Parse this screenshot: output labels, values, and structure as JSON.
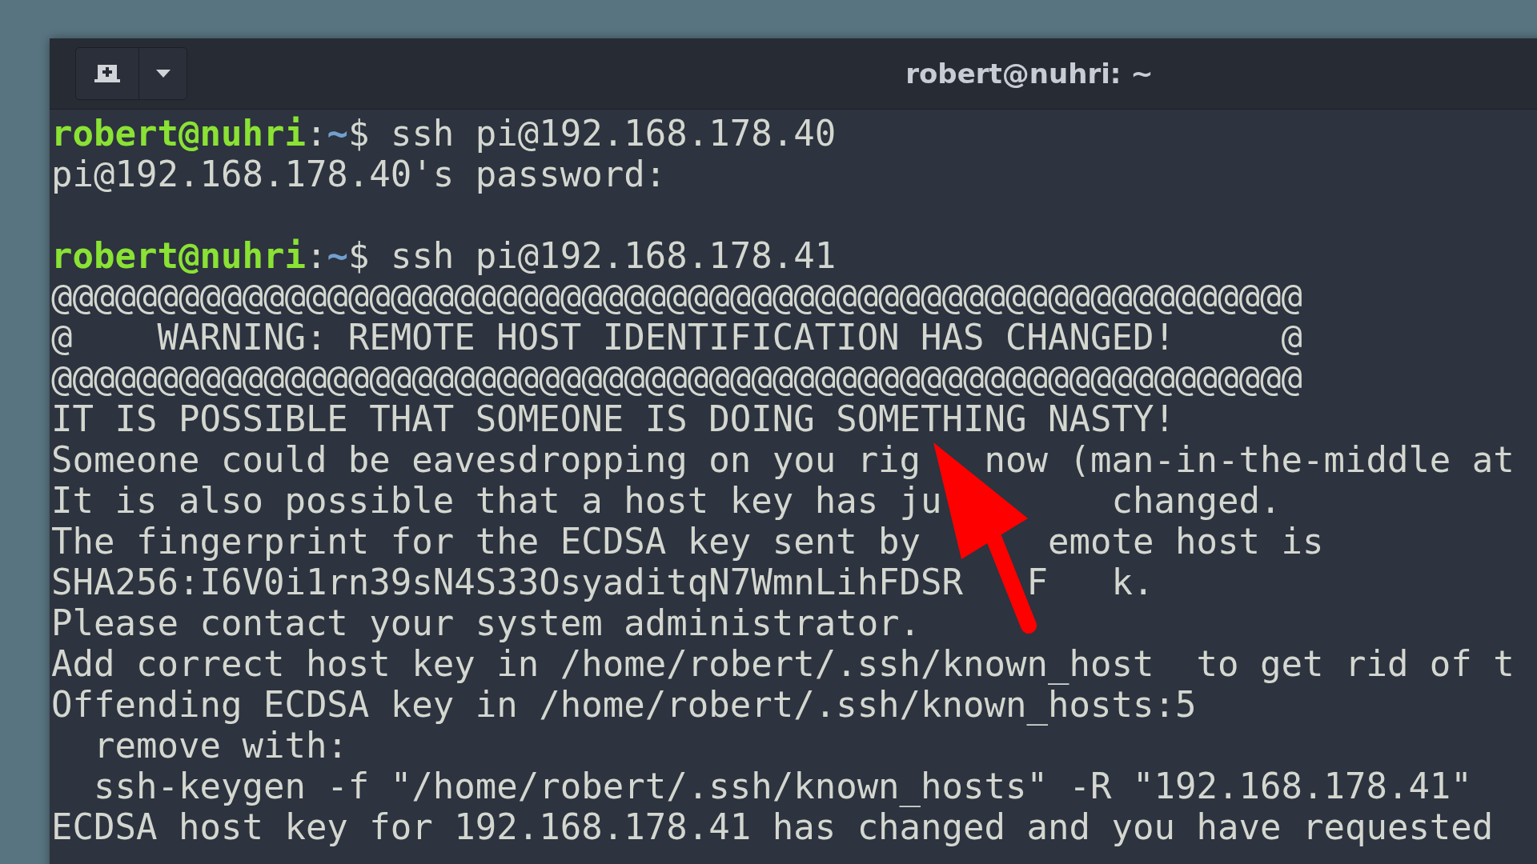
{
  "window": {
    "title": "robert@nuhri: ~"
  },
  "lines": [
    {
      "kind": "prompt",
      "user_host": "robert@nuhri",
      "separator": ":",
      "path": "~",
      "symbol": "$",
      "command": "ssh pi@192.168.178.40"
    },
    {
      "kind": "output",
      "text": "pi@192.168.178.40's password:"
    },
    {
      "kind": "blank"
    },
    {
      "kind": "prompt",
      "user_host": "robert@nuhri",
      "separator": ":",
      "path": "~",
      "symbol": "$",
      "command": "ssh pi@192.168.178.41"
    },
    {
      "kind": "output",
      "text": "@@@@@@@@@@@@@@@@@@@@@@@@@@@@@@@@@@@@@@@@@@@@@@@@@@@@@@@@@@@"
    },
    {
      "kind": "output",
      "text": "@    WARNING: REMOTE HOST IDENTIFICATION HAS CHANGED!     @"
    },
    {
      "kind": "output",
      "text": "@@@@@@@@@@@@@@@@@@@@@@@@@@@@@@@@@@@@@@@@@@@@@@@@@@@@@@@@@@@"
    },
    {
      "kind": "output",
      "text": "IT IS POSSIBLE THAT SOMEONE IS DOING SOMETHING NASTY!"
    },
    {
      "kind": "output",
      "text": "Someone could be eavesdropping on you rig   now (man-in-the-middle at"
    },
    {
      "kind": "output",
      "text": "It is also possible that a host key has ju        changed."
    },
    {
      "kind": "output",
      "text": "The fingerprint for the ECDSA key sent by      emote host is"
    },
    {
      "kind": "output",
      "text": "SHA256:I6V0i1rn39sN4S33OsyaditqN7WmnLihFDSR   F   k."
    },
    {
      "kind": "output",
      "text": "Please contact your system administrator."
    },
    {
      "kind": "output",
      "text": "Add correct host key in /home/robert/.ssh/known_host  to get rid of t"
    },
    {
      "kind": "output",
      "text": "Offending ECDSA key in /home/robert/.ssh/known_hosts:5"
    },
    {
      "kind": "output",
      "text": "  remove with:"
    },
    {
      "kind": "output",
      "text": "  ssh-keygen -f \"/home/robert/.ssh/known_hosts\" -R \"192.168.178.41\""
    },
    {
      "kind": "output",
      "text": "ECDSA host key for 192.168.178.41 has changed and you have requested"
    }
  ]
}
